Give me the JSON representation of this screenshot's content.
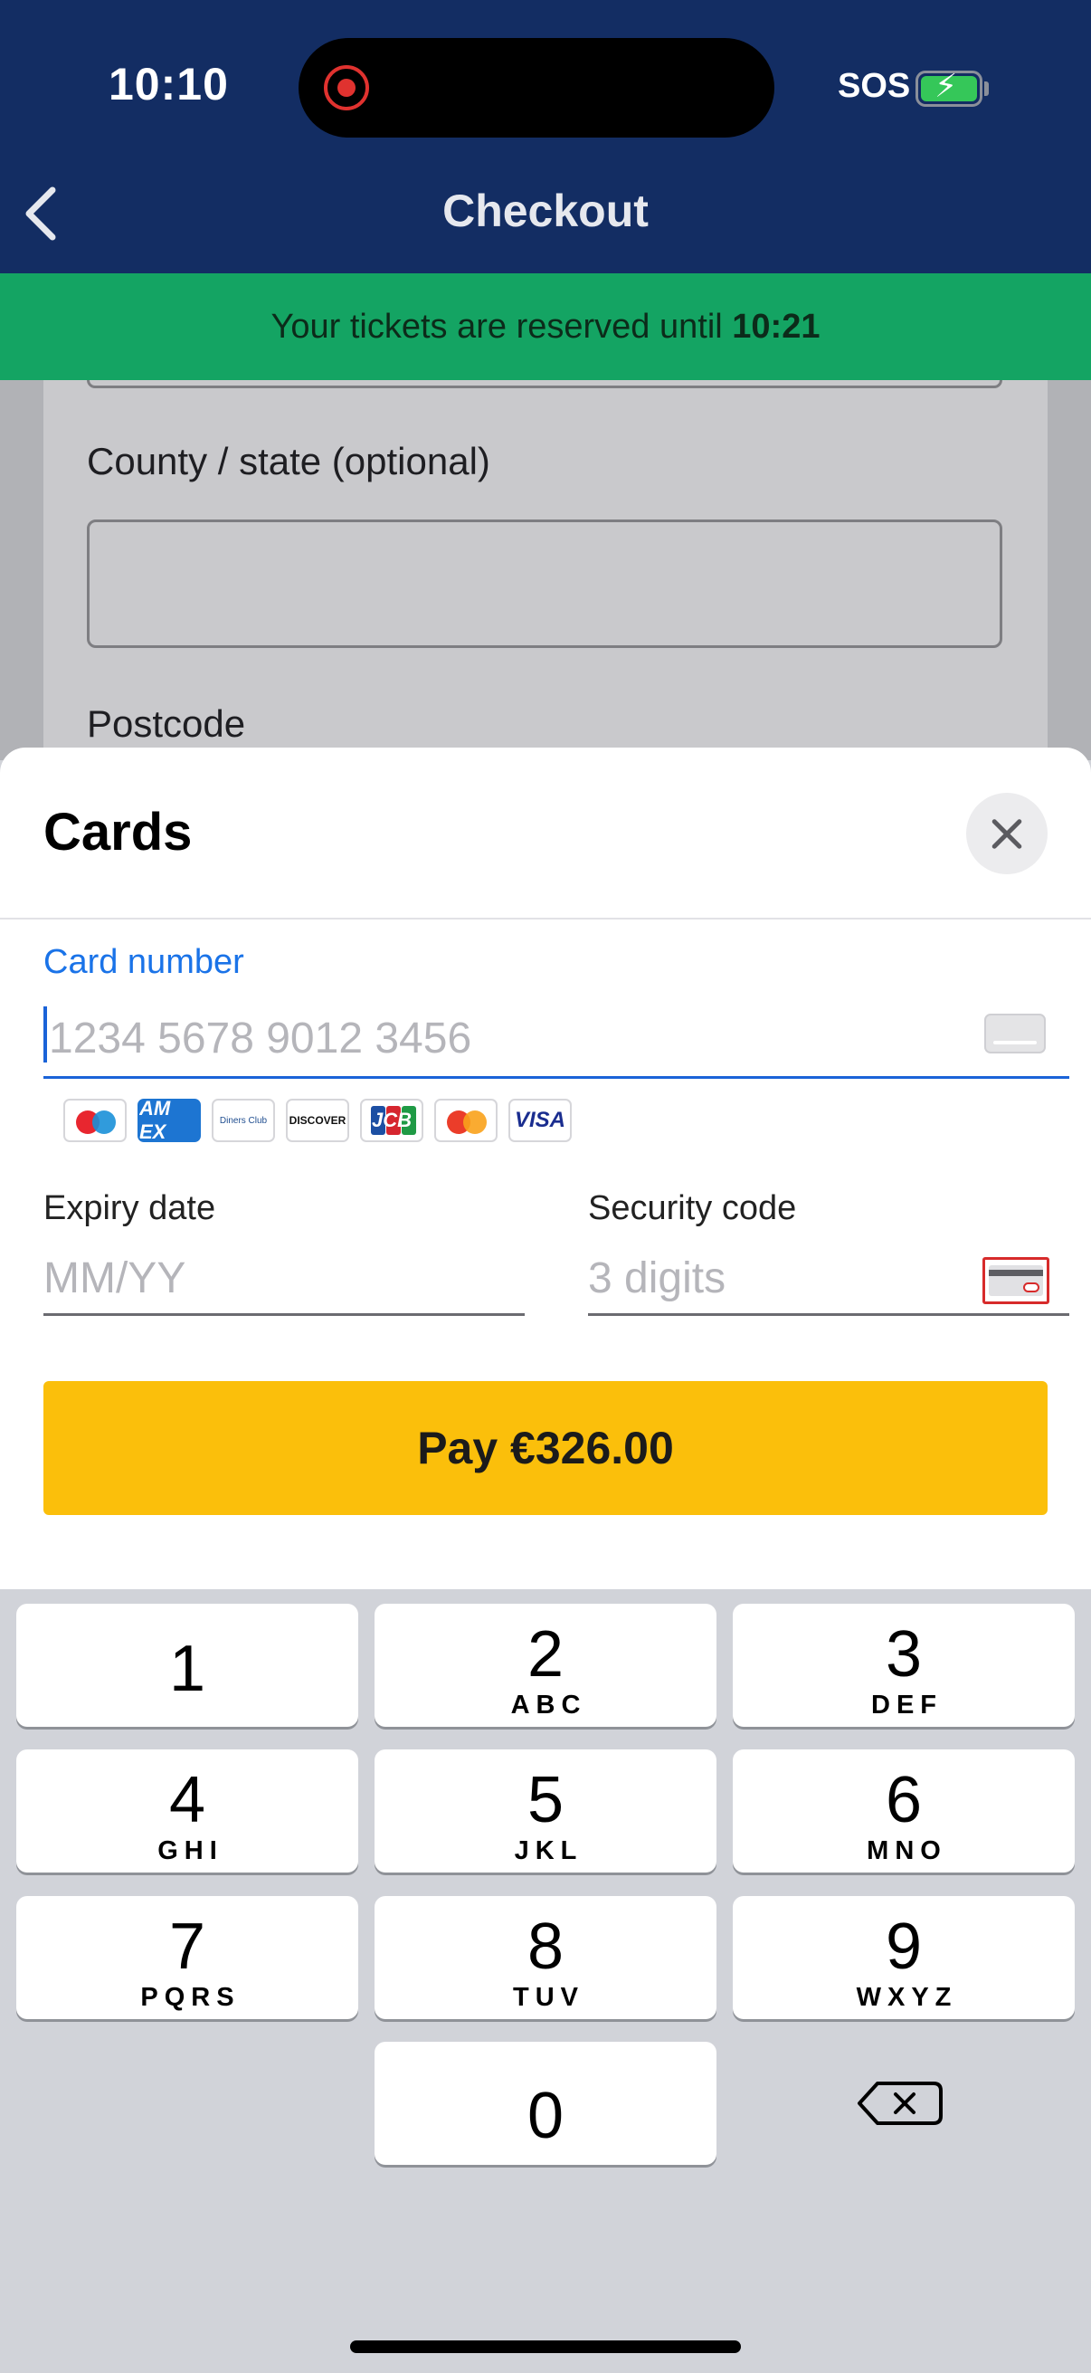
{
  "status_bar": {
    "time": "10:10",
    "carrier": "SOS"
  },
  "nav": {
    "title": "Checkout"
  },
  "banner": {
    "text": "Your tickets are reserved until ",
    "time": "10:21"
  },
  "background_form": {
    "county_label": "County / state (optional)",
    "postcode_label": "Postcode"
  },
  "sheet": {
    "title": "Cards",
    "card_number": {
      "label": "Card number",
      "placeholder": "1234 5678 9012 3456"
    },
    "card_brands": {
      "amex": "AM EX",
      "diners": "Diners Club",
      "discover": "DISCOVER",
      "jcb": "JCB",
      "visa": "VISA"
    },
    "expiry": {
      "label": "Expiry date",
      "placeholder": "MM/YY"
    },
    "security": {
      "label": "Security code",
      "placeholder": "3 digits"
    },
    "pay_button": "Pay €326.00"
  },
  "keypad": {
    "keys": [
      {
        "digit": "1",
        "letters": ""
      },
      {
        "digit": "2",
        "letters": "ABC"
      },
      {
        "digit": "3",
        "letters": "DEF"
      },
      {
        "digit": "4",
        "letters": "GHI"
      },
      {
        "digit": "5",
        "letters": "JKL"
      },
      {
        "digit": "6",
        "letters": "MNO"
      },
      {
        "digit": "7",
        "letters": "PQRS"
      },
      {
        "digit": "8",
        "letters": "TUV"
      },
      {
        "digit": "9",
        "letters": "WXYZ"
      },
      {
        "digit": "0",
        "letters": ""
      }
    ]
  },
  "colors": {
    "header": "#132d63",
    "banner": "#14a463",
    "accent_blue": "#1a73e8",
    "pay_button": "#fbbf0b"
  }
}
